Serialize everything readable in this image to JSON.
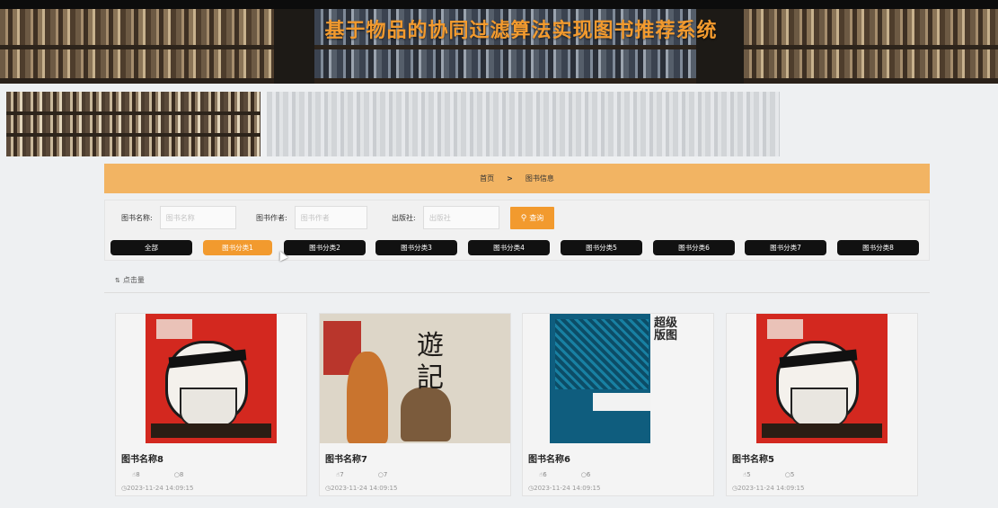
{
  "header": {
    "title": "基于物品的协同过滤算法实现图书推荐系统"
  },
  "breadcrumb": {
    "home": "首页",
    "separator": ">",
    "current": "图书信息"
  },
  "search": {
    "fields": [
      {
        "label": "图书名称:",
        "placeholder": "图书名称"
      },
      {
        "label": "图书作者:",
        "placeholder": "图书作者"
      },
      {
        "label": "出版社:",
        "placeholder": "出版社"
      }
    ],
    "button_label": "查询",
    "button_icon": "search-icon"
  },
  "categories": [
    {
      "label": "全部",
      "active": false
    },
    {
      "label": "图书分类1",
      "active": true
    },
    {
      "label": "图书分类2",
      "active": false
    },
    {
      "label": "图书分类3",
      "active": false
    },
    {
      "label": "图书分类4",
      "active": false
    },
    {
      "label": "图书分类5",
      "active": false
    },
    {
      "label": "图书分类6",
      "active": false
    },
    {
      "label": "图书分类7",
      "active": false
    },
    {
      "label": "图书分类8",
      "active": false
    }
  ],
  "sort": {
    "label": "点击量",
    "icon": "sort-icon"
  },
  "colors": {
    "accent": "#f29a2e",
    "breadcrumb_bg": "#f2b463",
    "category_bg": "#111111"
  },
  "books": [
    {
      "name": "图书名称8",
      "likes": "8",
      "comments": "8",
      "time": "2023-11-24 14:09:15",
      "cover": "red-warrior"
    },
    {
      "name": "图书名称7",
      "likes": "7",
      "comments": "7",
      "time": "2023-11-24 14:09:15",
      "cover": "journey-west"
    },
    {
      "name": "图书名称6",
      "likes": "6",
      "comments": "6",
      "time": "2023-11-24 14:09:15",
      "cover": "blue-map"
    },
    {
      "name": "图书名称5",
      "likes": "5",
      "comments": "5",
      "time": "2023-11-24 14:09:15",
      "cover": "red-warrior"
    }
  ],
  "cover_text": {
    "journey": "遊\n記",
    "blue": "超级版图"
  }
}
